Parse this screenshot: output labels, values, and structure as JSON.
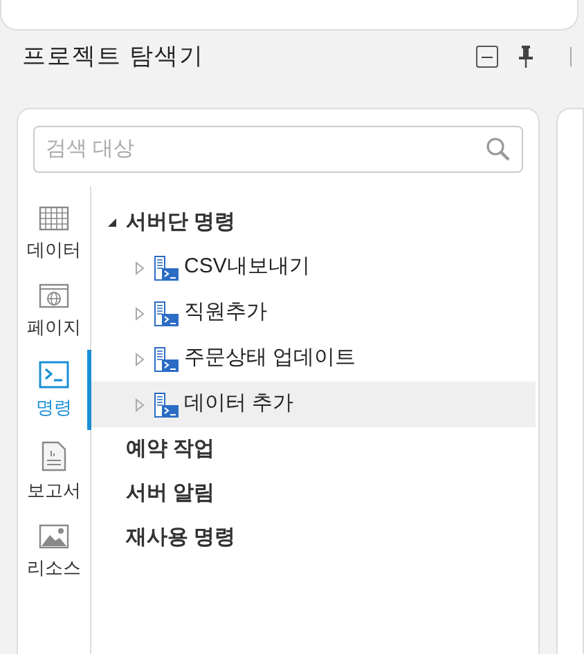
{
  "panel": {
    "title": "프로젝트 탐색기"
  },
  "search": {
    "placeholder": "검색 대상"
  },
  "nav": [
    {
      "label": "데이터",
      "kind": "grid",
      "selected": false
    },
    {
      "label": "페이지",
      "kind": "page",
      "selected": false
    },
    {
      "label": "명령",
      "kind": "terminal",
      "selected": true
    },
    {
      "label": "보고서",
      "kind": "report",
      "selected": false
    },
    {
      "label": "리소스",
      "kind": "image",
      "selected": false
    }
  ],
  "tree": [
    {
      "label": "서버단 명령",
      "expanded": true,
      "children": [
        {
          "label": "CSV내보내기",
          "selected": false
        },
        {
          "label": "직원추가",
          "selected": false
        },
        {
          "label": "주문상태 업데이트",
          "selected": false
        },
        {
          "label": "데이터 추가",
          "selected": true
        }
      ]
    },
    {
      "label": "예약 작업"
    },
    {
      "label": "서버 알림"
    },
    {
      "label": "재사용 명령"
    }
  ]
}
